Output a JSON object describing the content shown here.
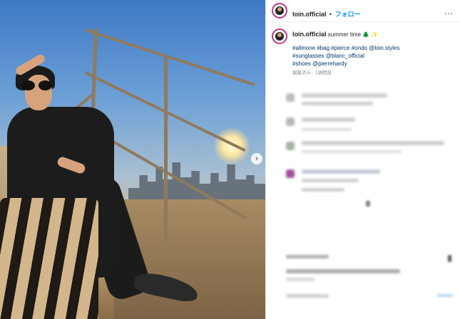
{
  "post": {
    "username": "loin.official",
    "separator": "•",
    "follow_label": "フォロー",
    "more_label": "...",
    "caption_user": "loin.official",
    "caption_text": "summer time 🌲 ✨",
    "hashtag_lines": [
      "#allinone #bag #pierce #ondo @loin.styles",
      "#sunglasses @blanc_official",
      "#shoes @pierrehardy"
    ],
    "meta": "編集済み · 1週間前",
    "carousel_next": "›"
  },
  "colors": {
    "accent": "#0095f6",
    "link": "#00376b",
    "text": "#262626",
    "muted": "#8e8e8e",
    "ring": "#c13584"
  },
  "icons": {
    "carousel": "chevron-right-icon",
    "more": "more-options-icon"
  }
}
